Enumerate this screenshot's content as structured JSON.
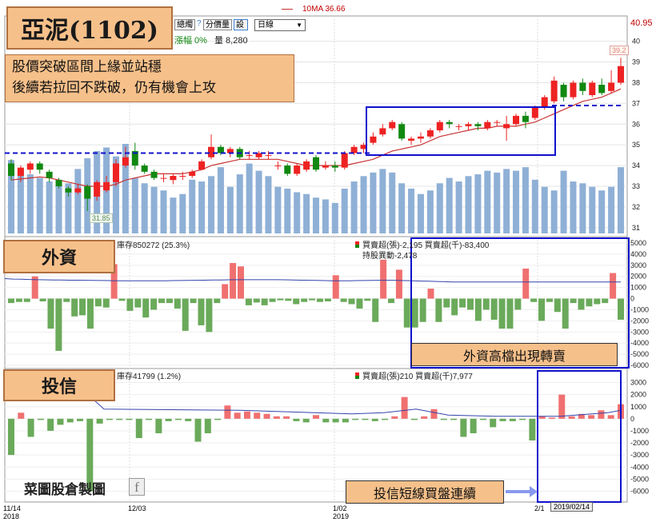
{
  "header": {
    "stock_title": "亞泥(1102)",
    "legend_ma": "10MA 36.66",
    "change_label": "漲幅 0%",
    "volume_label": "量 8,280",
    "btn_1": "總燭",
    "btn_help": "?",
    "btn_split": "分價量",
    "btn_set": "設",
    "period_select": "日線",
    "price_high_label": "40.95"
  },
  "annotations": {
    "main_note_line1": "股價突破區間上緣並站穩",
    "main_note_line2": "後續若拉回不跌破，仍有機會上攻",
    "foreign_tag": "外資",
    "foreign_callout": "外資高檔出現轉賣",
    "trust_tag": "投信",
    "trust_callout": "投信短線買盤連續",
    "watermark": "菜圖股倉製圖",
    "watermark_icon": "f",
    "last_price_tag": "39.2",
    "low_price_tag": "31.85"
  },
  "panels": {
    "foreign_info_left": "庫存850272 (25.3%)",
    "foreign_info_right": "買賣超(張)-2,195 買賣超(千)-83,400",
    "foreign_info_right2": "持股異動-2,478",
    "trust_info_left": "庫存41799 (1.2%)",
    "trust_info_right": "買賣超(張)210 買賣超(千)7,977"
  },
  "x_axis": {
    "labels": [
      {
        "date": "11/14",
        "year": "2018"
      },
      {
        "date": "12/03",
        "year": ""
      },
      {
        "date": "1/02",
        "year": "2019"
      },
      {
        "date": "2/1",
        "year": ""
      }
    ],
    "cursor_label": "2019/02/14"
  },
  "colors": {
    "up": "#ee2222",
    "down": "#118811",
    "ma": "#c83232",
    "volume": "#8fb0d6",
    "bar_up": "#f07070",
    "bar_down": "#6aaa5a",
    "hold_line": "#3344aa",
    "box": "#1010cc",
    "tag_bg": "#f6c08a"
  },
  "chart_data": [
    {
      "type": "candlestick",
      "title": "亞泥(1102)",
      "ylim": [
        30.8,
        40.95
      ],
      "yticks": [
        31,
        32,
        33,
        34,
        35,
        36,
        37,
        38,
        39,
        40
      ],
      "support_line": 34.6,
      "resistance_line": 36.9,
      "candles": [
        {
          "o": 34.1,
          "c": 33.5,
          "h": 34.3,
          "l": 33.3
        },
        {
          "o": 33.5,
          "c": 33.9,
          "h": 34.0,
          "l": 33.2
        },
        {
          "o": 33.8,
          "c": 34.1,
          "h": 34.2,
          "l": 33.6
        },
        {
          "o": 34.1,
          "c": 33.8,
          "h": 34.2,
          "l": 33.6
        },
        {
          "o": 33.7,
          "c": 33.4,
          "h": 33.8,
          "l": 33.2
        },
        {
          "o": 33.3,
          "c": 33.0,
          "h": 33.4,
          "l": 32.9
        },
        {
          "o": 32.9,
          "c": 32.7,
          "h": 33.0,
          "l": 32.5
        },
        {
          "o": 32.7,
          "c": 32.9,
          "h": 33.1,
          "l": 32.6
        },
        {
          "o": 33.0,
          "c": 32.4,
          "h": 33.1,
          "l": 31.8
        },
        {
          "o": 32.5,
          "c": 33.2,
          "h": 33.3,
          "l": 32.3
        },
        {
          "o": 32.8,
          "c": 33.2,
          "h": 33.5,
          "l": 32.7
        },
        {
          "o": 33.2,
          "c": 34.1,
          "h": 34.3,
          "l": 33.0
        },
        {
          "o": 34.0,
          "c": 34.4,
          "h": 34.9,
          "l": 33.9
        },
        {
          "o": 34.7,
          "c": 34.0,
          "h": 35.1,
          "l": 33.8
        },
        {
          "o": 34.0,
          "c": 33.7,
          "h": 34.1,
          "l": 33.6
        },
        {
          "o": 33.7,
          "c": 33.4,
          "h": 33.8,
          "l": 33.3
        },
        {
          "o": 33.4,
          "c": 33.4,
          "h": 33.6,
          "l": 33.2
        },
        {
          "o": 33.3,
          "c": 33.5,
          "h": 33.6,
          "l": 33.1
        },
        {
          "o": 33.5,
          "c": 33.5,
          "h": 33.7,
          "l": 33.3
        },
        {
          "o": 33.5,
          "c": 33.7,
          "h": 33.8,
          "l": 33.4
        },
        {
          "o": 33.8,
          "c": 34.2,
          "h": 34.3,
          "l": 33.8
        },
        {
          "o": 34.4,
          "c": 34.9,
          "h": 35.5,
          "l": 34.3
        },
        {
          "o": 34.9,
          "c": 34.6,
          "h": 35.0,
          "l": 34.5
        },
        {
          "o": 34.6,
          "c": 34.8,
          "h": 34.9,
          "l": 34.4
        },
        {
          "o": 34.8,
          "c": 34.4,
          "h": 34.9,
          "l": 34.3
        },
        {
          "o": 34.5,
          "c": 34.5,
          "h": 34.7,
          "l": 34.3
        },
        {
          "o": 34.4,
          "c": 34.6,
          "h": 34.7,
          "l": 34.3
        },
        {
          "o": 34.5,
          "c": 34.5,
          "h": 34.7,
          "l": 34.3
        },
        {
          "o": 34.0,
          "c": 34.0,
          "h": 34.2,
          "l": 33.8
        },
        {
          "o": 34.0,
          "c": 33.6,
          "h": 34.1,
          "l": 33.5
        },
        {
          "o": 33.6,
          "c": 34.0,
          "h": 34.1,
          "l": 33.5
        },
        {
          "o": 33.8,
          "c": 34.2,
          "h": 34.3,
          "l": 33.7
        },
        {
          "o": 34.4,
          "c": 33.8,
          "h": 34.5,
          "l": 33.7
        },
        {
          "o": 33.9,
          "c": 34.0,
          "h": 34.2,
          "l": 33.8
        },
        {
          "o": 34.0,
          "c": 33.9,
          "h": 34.2,
          "l": 33.7
        },
        {
          "o": 33.9,
          "c": 34.6,
          "h": 34.7,
          "l": 33.8
        },
        {
          "o": 34.6,
          "c": 34.9,
          "h": 35.0,
          "l": 34.5
        },
        {
          "o": 34.8,
          "c": 35.0,
          "h": 35.1,
          "l": 34.6
        },
        {
          "o": 35.1,
          "c": 35.4,
          "h": 35.6,
          "l": 35.0
        },
        {
          "o": 35.5,
          "c": 35.8,
          "h": 36.0,
          "l": 35.4
        },
        {
          "o": 35.8,
          "c": 36.1,
          "h": 36.2,
          "l": 35.7
        },
        {
          "o": 36.0,
          "c": 35.3,
          "h": 36.1,
          "l": 35.2
        },
        {
          "o": 35.2,
          "c": 35.3,
          "h": 35.4,
          "l": 35.0
        },
        {
          "o": 35.3,
          "c": 35.4,
          "h": 35.6,
          "l": 35.1
        },
        {
          "o": 35.4,
          "c": 35.7,
          "h": 35.8,
          "l": 35.3
        },
        {
          "o": 35.7,
          "c": 36.1,
          "h": 36.2,
          "l": 35.6
        },
        {
          "o": 36.1,
          "c": 36.0,
          "h": 36.2,
          "l": 35.8
        },
        {
          "o": 35.9,
          "c": 35.9,
          "h": 36.0,
          "l": 35.7
        },
        {
          "o": 35.9,
          "c": 36.0,
          "h": 36.1,
          "l": 35.7
        },
        {
          "o": 36.0,
          "c": 35.9,
          "h": 36.1,
          "l": 35.7
        },
        {
          "o": 35.8,
          "c": 36.1,
          "h": 36.2,
          "l": 35.7
        },
        {
          "o": 36.1,
          "c": 36.1,
          "h": 36.2,
          "l": 35.9
        },
        {
          "o": 35.8,
          "c": 36.0,
          "h": 36.4,
          "l": 35.2
        },
        {
          "o": 36.0,
          "c": 36.4,
          "h": 36.5,
          "l": 35.9
        },
        {
          "o": 36.4,
          "c": 36.1,
          "h": 36.6,
          "l": 35.8
        },
        {
          "o": 36.3,
          "c": 36.8,
          "h": 36.9,
          "l": 36.2
        },
        {
          "o": 36.8,
          "c": 37.3,
          "h": 37.4,
          "l": 36.7
        },
        {
          "o": 37.1,
          "c": 38.1,
          "h": 38.3,
          "l": 37.0
        },
        {
          "o": 37.9,
          "c": 37.3,
          "h": 38.0,
          "l": 37.1
        },
        {
          "o": 37.3,
          "c": 38.0,
          "h": 38.1,
          "l": 37.2
        },
        {
          "o": 38.0,
          "c": 37.6,
          "h": 38.2,
          "l": 37.4
        },
        {
          "o": 37.4,
          "c": 38.0,
          "h": 38.1,
          "l": 37.3
        },
        {
          "o": 37.9,
          "c": 37.5,
          "h": 38.2,
          "l": 37.4
        },
        {
          "o": 37.6,
          "c": 38.0,
          "h": 38.6,
          "l": 37.5
        },
        {
          "o": 38.0,
          "c": 38.8,
          "h": 39.2,
          "l": 37.9
        }
      ],
      "ma10": [
        33.3,
        33.35,
        33.4,
        33.45,
        33.4,
        33.3,
        33.2,
        33.1,
        33.0,
        33.0,
        33.0,
        33.1,
        33.3,
        33.4,
        33.5,
        33.6,
        33.6,
        33.6,
        33.6,
        33.7,
        33.8,
        34.0,
        34.1,
        34.2,
        34.3,
        34.3,
        34.3,
        34.3,
        34.3,
        34.2,
        34.1,
        34.0,
        34.0,
        34.0,
        34.0,
        34.0,
        34.1,
        34.2,
        34.3,
        34.5,
        34.7,
        34.8,
        34.9,
        35.0,
        35.2,
        35.4,
        35.5,
        35.6,
        35.7,
        35.8,
        35.8,
        35.9,
        35.9,
        35.9,
        36.0,
        36.1,
        36.3,
        36.5,
        36.7,
        36.9,
        37.1,
        37.2,
        37.3,
        37.5,
        37.7
      ],
      "volume": [
        82,
        70,
        66,
        62,
        58,
        60,
        56,
        72,
        84,
        92,
        96,
        86,
        100,
        62,
        56,
        52,
        48,
        40,
        44,
        60,
        58,
        64,
        74,
        52,
        66,
        78,
        70,
        64,
        52,
        50,
        46,
        44,
        40,
        38,
        34,
        50,
        58,
        64,
        68,
        72,
        68,
        56,
        50,
        44,
        48,
        56,
        62,
        58,
        64,
        66,
        70,
        68,
        72,
        70,
        74,
        60,
        52,
        48,
        70,
        58,
        56,
        52,
        48,
        52,
        74
      ],
      "volume_unit": "relative"
    },
    {
      "type": "bar",
      "title": "外資",
      "ylim": [
        -6000,
        5000
      ],
      "yticks": [
        5000,
        4000,
        3000,
        2000,
        1000,
        0,
        -1000,
        -2000,
        -3000,
        -4000,
        -5000,
        -6000
      ],
      "values": [
        -400,
        -300,
        -300,
        2000,
        -250,
        -2700,
        -4700,
        -300,
        -1600,
        -1500,
        -2700,
        -700,
        -800,
        3100,
        -200,
        -1100,
        -800,
        -1700,
        -1000,
        -400,
        -400,
        -900,
        -2900,
        -400,
        -2400,
        -3000,
        -400,
        1300,
        3200,
        2900,
        -600,
        -350,
        -600,
        -300,
        -150,
        -200,
        -500,
        -300,
        -150,
        -300,
        -250,
        2100,
        -300,
        -500,
        -900,
        -200,
        -2100,
        3500,
        -400,
        2600,
        -2600,
        -2600,
        -2100,
        900,
        -2100,
        -800,
        -1500,
        -800,
        -1000,
        -2000,
        -1000,
        -1900,
        -2700,
        -2700,
        -1000,
        2700,
        -300,
        -2000,
        -300,
        -1200,
        -2700,
        -400,
        -1000,
        -700,
        -500,
        -400,
        2300,
        -1900
      ],
      "hold_line": [
        1800,
        1760,
        1740,
        1720,
        1700,
        1690,
        1680,
        1670,
        1660,
        1655,
        1650,
        1640,
        1630,
        1620,
        1610,
        1600,
        1600,
        1600,
        1600,
        1600,
        1610,
        1620,
        1630,
        1640,
        1650,
        1660,
        1670,
        1680,
        1690,
        1700,
        1700,
        1700,
        1700,
        1700,
        1700,
        1690,
        1680,
        1660,
        1650,
        1640,
        1620,
        1600,
        1600,
        1610,
        1620,
        1630,
        1640,
        1650,
        1650,
        1640,
        1620,
        1600,
        1580,
        1560,
        1540,
        1520,
        1500,
        1500,
        1500,
        1500,
        1500,
        1500,
        1500,
        1500,
        1500,
        1500,
        1500,
        1500,
        1500,
        1500,
        1500,
        1500,
        1500,
        1500,
        1500,
        1500,
        1500,
        1500
      ]
    },
    {
      "type": "bar",
      "title": "投信",
      "ylim": [
        -6500,
        3500
      ],
      "yticks": [
        3000,
        2000,
        1000,
        0,
        -1000,
        -2000,
        -3000,
        -4000,
        -5000,
        -6000
      ],
      "values": [
        -3000,
        500,
        -1500,
        -100,
        -1000,
        -500,
        -300,
        -200,
        -6000,
        -400,
        -100,
        -100,
        -100,
        -1600,
        -100,
        -1200,
        -200,
        -100,
        -200,
        -1900,
        -1200,
        -100,
        1100,
        500,
        600,
        500,
        400,
        200,
        200,
        -200,
        -300,
        300,
        -300,
        -300,
        -300,
        -100,
        -100,
        -200,
        -100,
        200,
        1800,
        -100,
        200,
        800,
        -100,
        -100,
        -1500,
        -1200,
        -100,
        -700,
        -200,
        -200,
        -100,
        -1800,
        200,
        100,
        2000,
        200,
        400,
        300,
        700,
        300,
        1200
      ]
    }
  ]
}
